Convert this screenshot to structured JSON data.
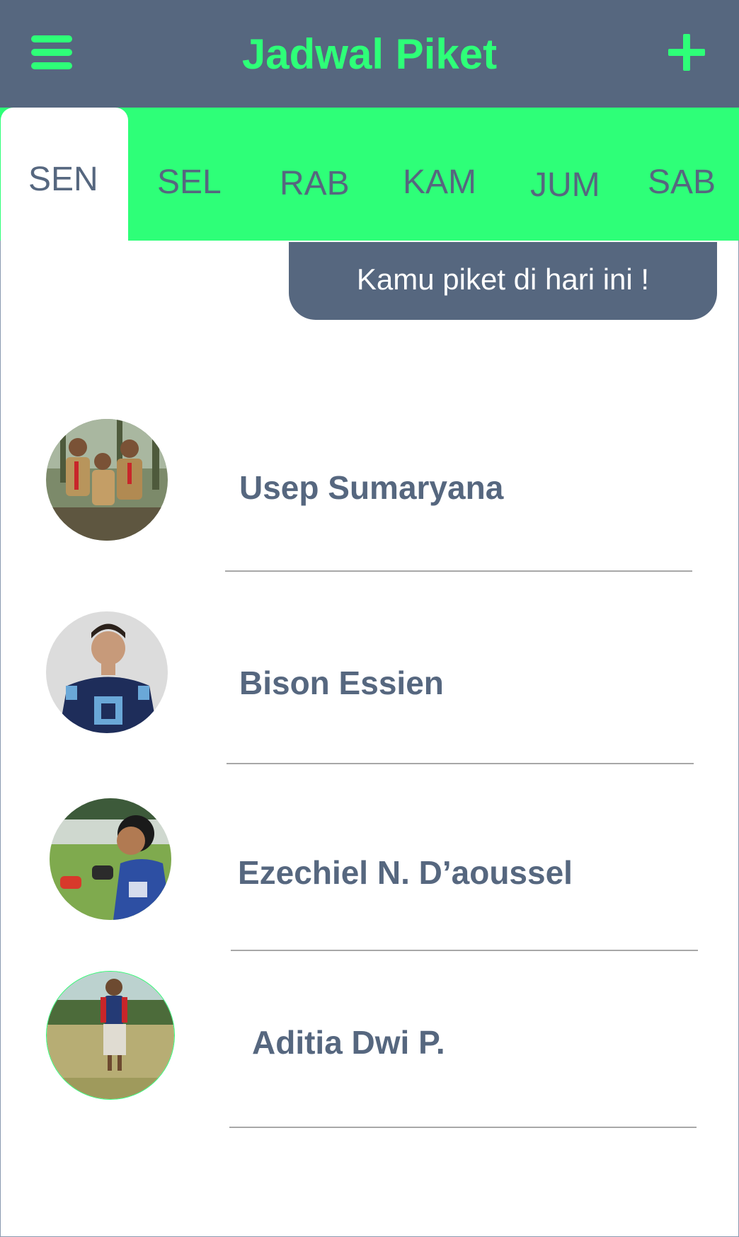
{
  "header": {
    "title": "Jadwal Piket",
    "menu_icon": "hamburger-menu-icon",
    "add_icon": "plus-icon"
  },
  "tabs": [
    {
      "label": "SEN",
      "active": true
    },
    {
      "label": "SEL",
      "active": false
    },
    {
      "label": "RAB",
      "active": false
    },
    {
      "label": "KAM",
      "active": false
    },
    {
      "label": "JUM",
      "active": false
    },
    {
      "label": "SAB",
      "active": false
    }
  ],
  "banner": {
    "text": "Kamu piket di hari ini !"
  },
  "members": [
    {
      "name": "Usep Sumaryana"
    },
    {
      "name": "Bison Essien"
    },
    {
      "name": "Ezechiel N. D’aoussel"
    },
    {
      "name": "Aditia Dwi P."
    }
  ],
  "colors": {
    "primary": "#56677f",
    "accent": "#2eff78",
    "background": "#ffffff"
  }
}
